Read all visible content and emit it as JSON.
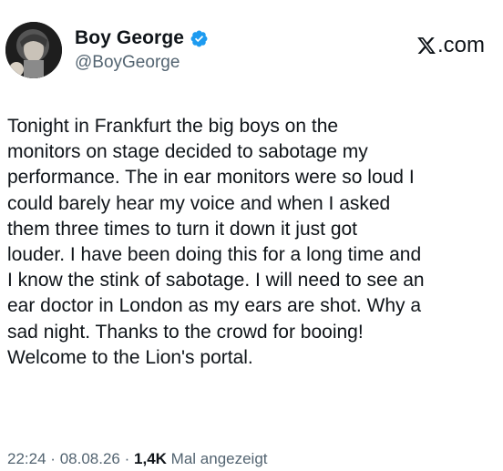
{
  "author": {
    "display_name": "Boy George",
    "handle": "@BoyGeorge",
    "verified_icon": "verified-badge-icon",
    "badge_color": "#1d9bf0"
  },
  "brand": {
    "label": ".com",
    "icon": "x-logo-icon"
  },
  "post": {
    "text": "Tonight  in Frankfurt the big boys on the\nmonitors on stage decided to sabotage my\nperformance. The in ear monitors were so loud I\ncould barely hear my voice and when I asked\nthem three times to turn it down it just got\nlouder.  I have been doing this for a long time and\nI know the stink of sabotage. I will need to see an\near doctor in London as my ears are shot. Why a\nsad night. Thanks to the crowd for booing!\nWelcome to the Lion's portal."
  },
  "meta": {
    "time": "22:24",
    "separator": "·",
    "date": "08.08.26",
    "views_count": "1,4K",
    "views_label": "Mal angezeigt"
  }
}
